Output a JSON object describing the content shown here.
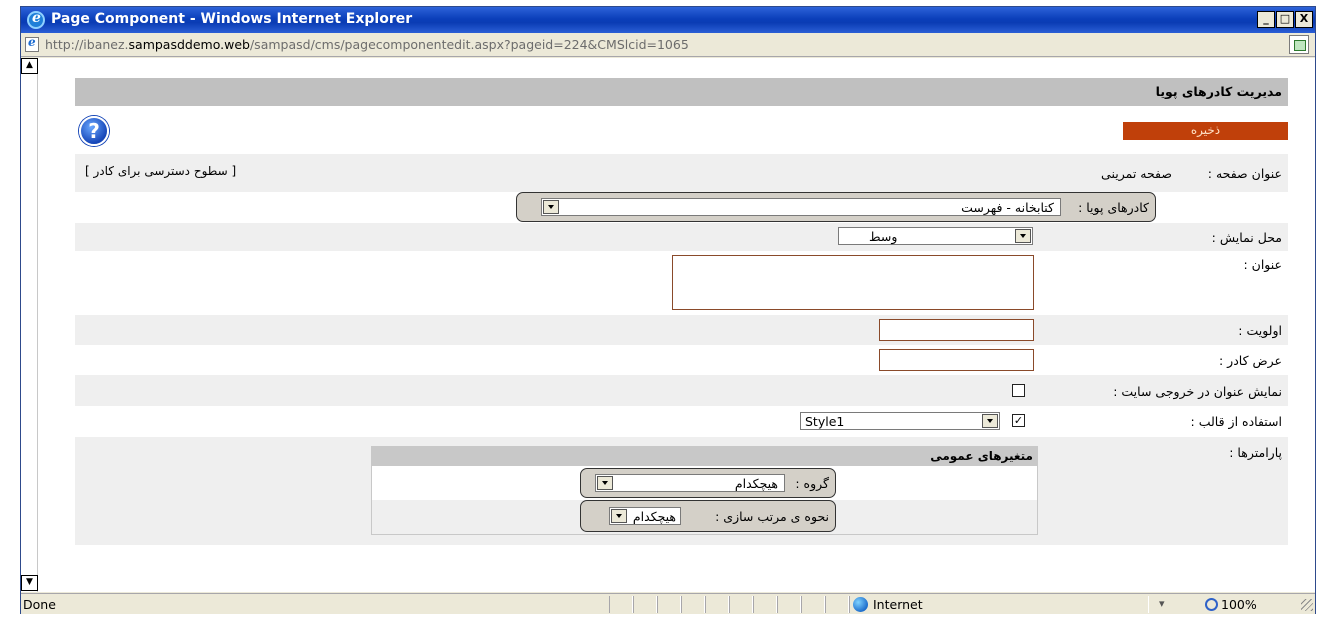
{
  "window": {
    "title": "Page Component - Windows Internet Explorer",
    "minimize": "_",
    "maximize": "□",
    "close": "X"
  },
  "address": {
    "prefix": "http://ibanez.",
    "host": "sampasddemo.web",
    "path": "/sampasd/cms/pagecomponentedit.aspx?pageid=224&CMSlcid=1065"
  },
  "page": {
    "header": "مدیریت کادرهای پویا",
    "help": "?",
    "save": "ذخیره"
  },
  "form": {
    "page_title_label": "عنوان صفحه :",
    "page_title_value": "صفحه تمرینی",
    "access_link": "[ سطوح دسترسی برای کادر ]",
    "dynamic_frames_label": "کادرهای پویا :",
    "dynamic_frames_value": "کتابخانه - فهرست",
    "display_location_label": "محل نمایش :",
    "display_location_value": "وسط",
    "title_label": "عنوان :",
    "priority_label": "اولویت :",
    "frame_width_label": "عرض کادر :",
    "show_title_label": "نمایش عنوان در خروجی سایت :",
    "show_title_checked": false,
    "use_template_label": "استفاده از قالب :",
    "use_template_checked": true,
    "template_value": "Style1",
    "params_label": "پارامترها :"
  },
  "params": {
    "header": "متغیرهای عمومی",
    "group_label": "گروه :",
    "group_value": "هیچکدام",
    "sort_label": "نحوه ی مرتب سازی :",
    "sort_value": "هیچکدام"
  },
  "status": {
    "done": "Done",
    "zone": "Internet",
    "protected_mode": "▾",
    "zoom": "100%"
  },
  "colors": {
    "save_button": "#c0400a",
    "titlebar": "#0a3cb4",
    "header_band": "#c0c0c0"
  }
}
